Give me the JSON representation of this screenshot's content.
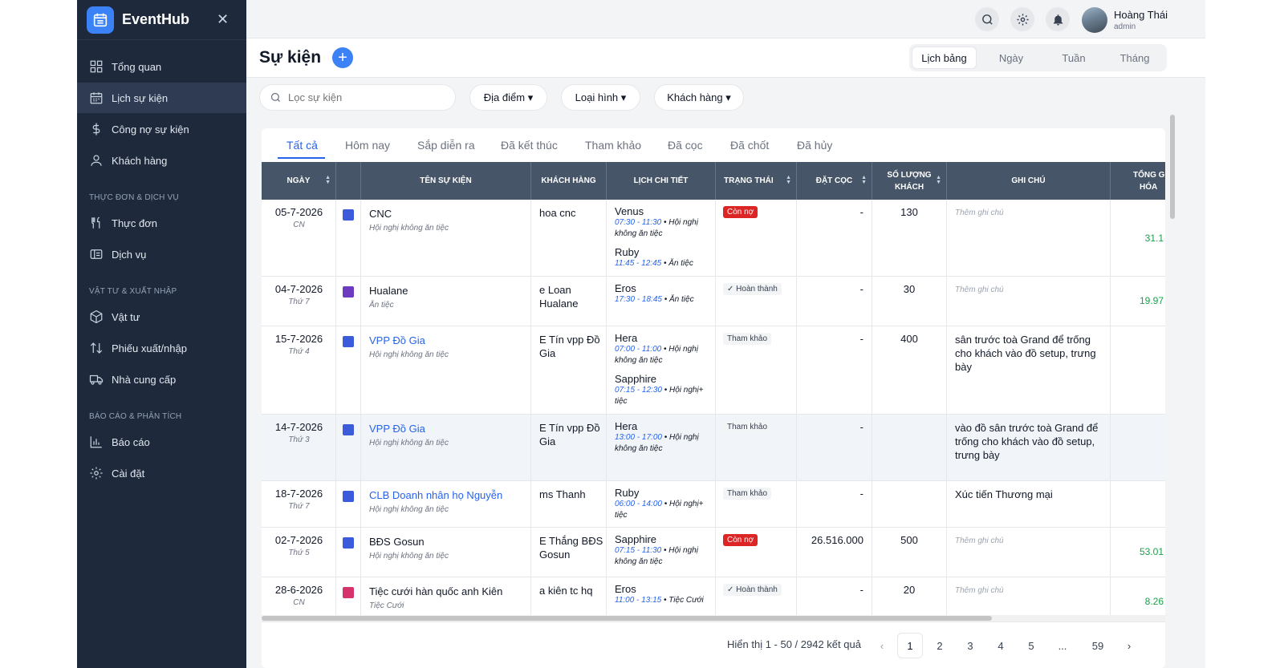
{
  "app": {
    "name": "EventHub"
  },
  "sidebar": {
    "items": [
      {
        "label": "Tổng quan"
      },
      {
        "label": "Lịch sự kiện"
      },
      {
        "label": "Công nợ sự kiện"
      },
      {
        "label": "Khách hàng"
      },
      {
        "label": "Thực đơn"
      },
      {
        "label": "Dịch vụ"
      },
      {
        "label": "Vật tư"
      },
      {
        "label": "Phiếu xuất/nhập"
      },
      {
        "label": "Nhà cung cấp"
      },
      {
        "label": "Báo cáo"
      },
      {
        "label": "Cài đặt"
      }
    ],
    "sections": [
      "THỰC ĐƠN & DỊCH VỤ",
      "VẬT TƯ & XUẤT NHẬP",
      "BÁO CÁO & PHÂN TÍCH"
    ]
  },
  "user": {
    "name": "Hoàng Thái",
    "role": "admin"
  },
  "page": {
    "title": "Sự kiện",
    "add_label": "+"
  },
  "views": [
    "Lịch bảng",
    "Ngày",
    "Tuần",
    "Tháng"
  ],
  "filters": {
    "search_placeholder": "Lọc sự kiện",
    "buttons": [
      "Địa điểm ▾",
      "Loại hình ▾",
      "Khách hàng ▾"
    ]
  },
  "tabs": [
    "Tất cả",
    "Hôm nay",
    "Sắp diễn ra",
    "Đã kết thúc",
    "Tham khảo",
    "Đã cọc",
    "Đã chốt",
    "Đã hủy"
  ],
  "table": {
    "headers": [
      "NGÀY",
      "TÊN SỰ KIỆN",
      "KHÁCH HÀNG",
      "LỊCH CHI TIẾT",
      "TRẠNG THÁI",
      "ĐẶT CỌC",
      "SỐ LƯỢNG",
      "KHÁCH",
      "GHI CHÚ",
      "TỔNG G",
      "HÓA"
    ],
    "rows": [
      {
        "date": "05-7-2026",
        "dow": "CN",
        "color": "#3b5bdb",
        "name": "CNC",
        "type": "Hội nghị không ăn tiệc",
        "customer": "hoa cnc",
        "sched": [
          {
            "room": "Venus",
            "time": "07:30 - 11:30",
            "desc": " • Hội nghị không ăn tiệc"
          },
          {
            "room": "Ruby",
            "time": "11:45 - 12:45",
            "desc": " • Ăn tiệc"
          }
        ],
        "status": "Còn nợ",
        "deposit": "-",
        "guests": "130",
        "note": "Thêm ghi chú",
        "total": "31.1"
      },
      {
        "date": "04-7-2026",
        "dow": "Thứ 7",
        "color": "#6d3bbf",
        "name": "Hualane",
        "type": "Ăn tiệc",
        "customer": "e Loan Hualane",
        "sched": [
          {
            "room": "Eros",
            "time": "17:30 - 18:45",
            "desc": " • Ăn tiệc"
          }
        ],
        "status": "✓ Hoàn thành",
        "deposit": "-",
        "guests": "30",
        "note": "Thêm ghi chú",
        "total": "19.97"
      },
      {
        "date": "15-7-2026",
        "dow": "Thứ 4",
        "color": "#3b5bdb",
        "name": "VPP Đồ Gia",
        "type": "Hội nghị không ăn tiệc",
        "customer": "E Tín vpp Đồ Gia",
        "sched": [
          {
            "room": "Hera",
            "time": "07:00 - 11:00",
            "desc": " • Hội nghị không ăn tiệc"
          },
          {
            "room": "Sapphire",
            "time": "07:15 - 12:30",
            "desc": " • Hội nghị+ tiệc"
          }
        ],
        "status": "Tham khảo",
        "deposit": "-",
        "guests": "400",
        "note": "sân trước toà Grand để trống cho khách vào đồ setup, trưng bày",
        "total": ""
      },
      {
        "date": "14-7-2026",
        "dow": "Thứ 3",
        "color": "#3b5bdb",
        "name": "VPP Đồ Gia",
        "type": "Hội nghị không ăn tiệc",
        "customer": "E Tín vpp Đồ Gia",
        "sched": [
          {
            "room": "Hera",
            "time": "13:00 - 17:00",
            "desc": " • Hội nghị không ăn tiệc"
          }
        ],
        "status": "Tham khảo",
        "deposit": "-",
        "guests": "",
        "note": "vào đồ sân trước toà Grand để trống cho khách vào đồ setup, trưng bày",
        "total": ""
      },
      {
        "date": "18-7-2026",
        "dow": "Thứ 7",
        "color": "#3b5bdb",
        "name": "CLB Doanh nhân họ Nguyễn",
        "type": "Hội nghị không ăn tiệc",
        "customer": "ms Thanh",
        "sched": [
          {
            "room": "Ruby",
            "time": "06:00 - 14:00",
            "desc": " • Hội nghị+ tiệc"
          }
        ],
        "status": "Tham khảo",
        "deposit": "-",
        "guests": "",
        "note": "Xúc tiến Thương mại",
        "total": ""
      },
      {
        "date": "02-7-2026",
        "dow": "Thứ 5",
        "color": "#3b5bdb",
        "name": "BĐS Gosun",
        "type": "Hội nghị không ăn tiệc",
        "customer": "E Thắng BĐS Gosun",
        "sched": [
          {
            "room": "Sapphire",
            "time": "07:15 - 11:30",
            "desc": " • Hội nghị không ăn tiệc"
          }
        ],
        "status": "Còn nợ",
        "deposit": "26.516.000",
        "guests": "500",
        "note": "Thêm ghi chú",
        "total": "53.01"
      },
      {
        "date": "28-6-2026",
        "dow": "CN",
        "color": "#d6336c",
        "name": "Tiệc cưới hàn quốc anh Kiên",
        "type": "Tiệc Cưới",
        "customer": "a kiên tc hq",
        "sched": [
          {
            "room": "Eros",
            "time": "11:00 - 13:15",
            "desc": " • Tiệc Cưới"
          }
        ],
        "status": "✓ Hoàn thành",
        "deposit": "-",
        "guests": "20",
        "note": "Thêm ghi chú",
        "total": "8.26"
      }
    ]
  },
  "pagination": {
    "info": "Hiển thị 1 - 50 / 2942 kết quả",
    "pages": [
      "1",
      "2",
      "3",
      "4",
      "5",
      "...",
      "59"
    ],
    "prev": "‹",
    "next": "›"
  }
}
